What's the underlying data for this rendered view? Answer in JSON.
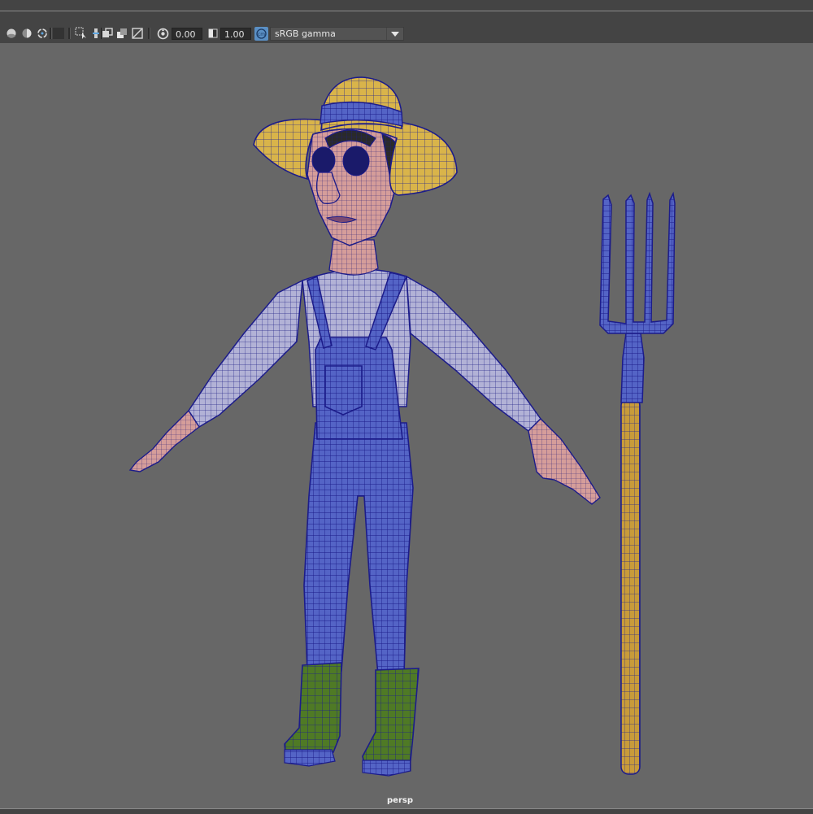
{
  "window": {
    "camera_label": "persp"
  },
  "toolbar": {
    "icons": [
      "shaded-sphere-icon",
      "half-sphere-icon",
      "rotate-sphere-icon",
      "dark-square-icon",
      "select-lasso-icon",
      "pivot-icon",
      "overlap-squares-icon",
      "layers-icon",
      "resolution-icon",
      "gamma-dial-icon",
      "exposure-icon"
    ],
    "exposure_value": "0.00",
    "gamma_value": "1.00",
    "color_management_icon": "color-management-icon",
    "view_transform": "sRGB gamma"
  },
  "colors": {
    "chrome": "#444444",
    "viewport_bg": "#676767",
    "wire": "#1c1c8a",
    "overalls": "#5464c6",
    "shirt": "#b2b2d6",
    "skin": "#d59d9a",
    "hat_straw": "#d9b44a",
    "hat_band": "#5a78c8",
    "boots": "#4f7a25",
    "handle": "#c89b3a"
  }
}
